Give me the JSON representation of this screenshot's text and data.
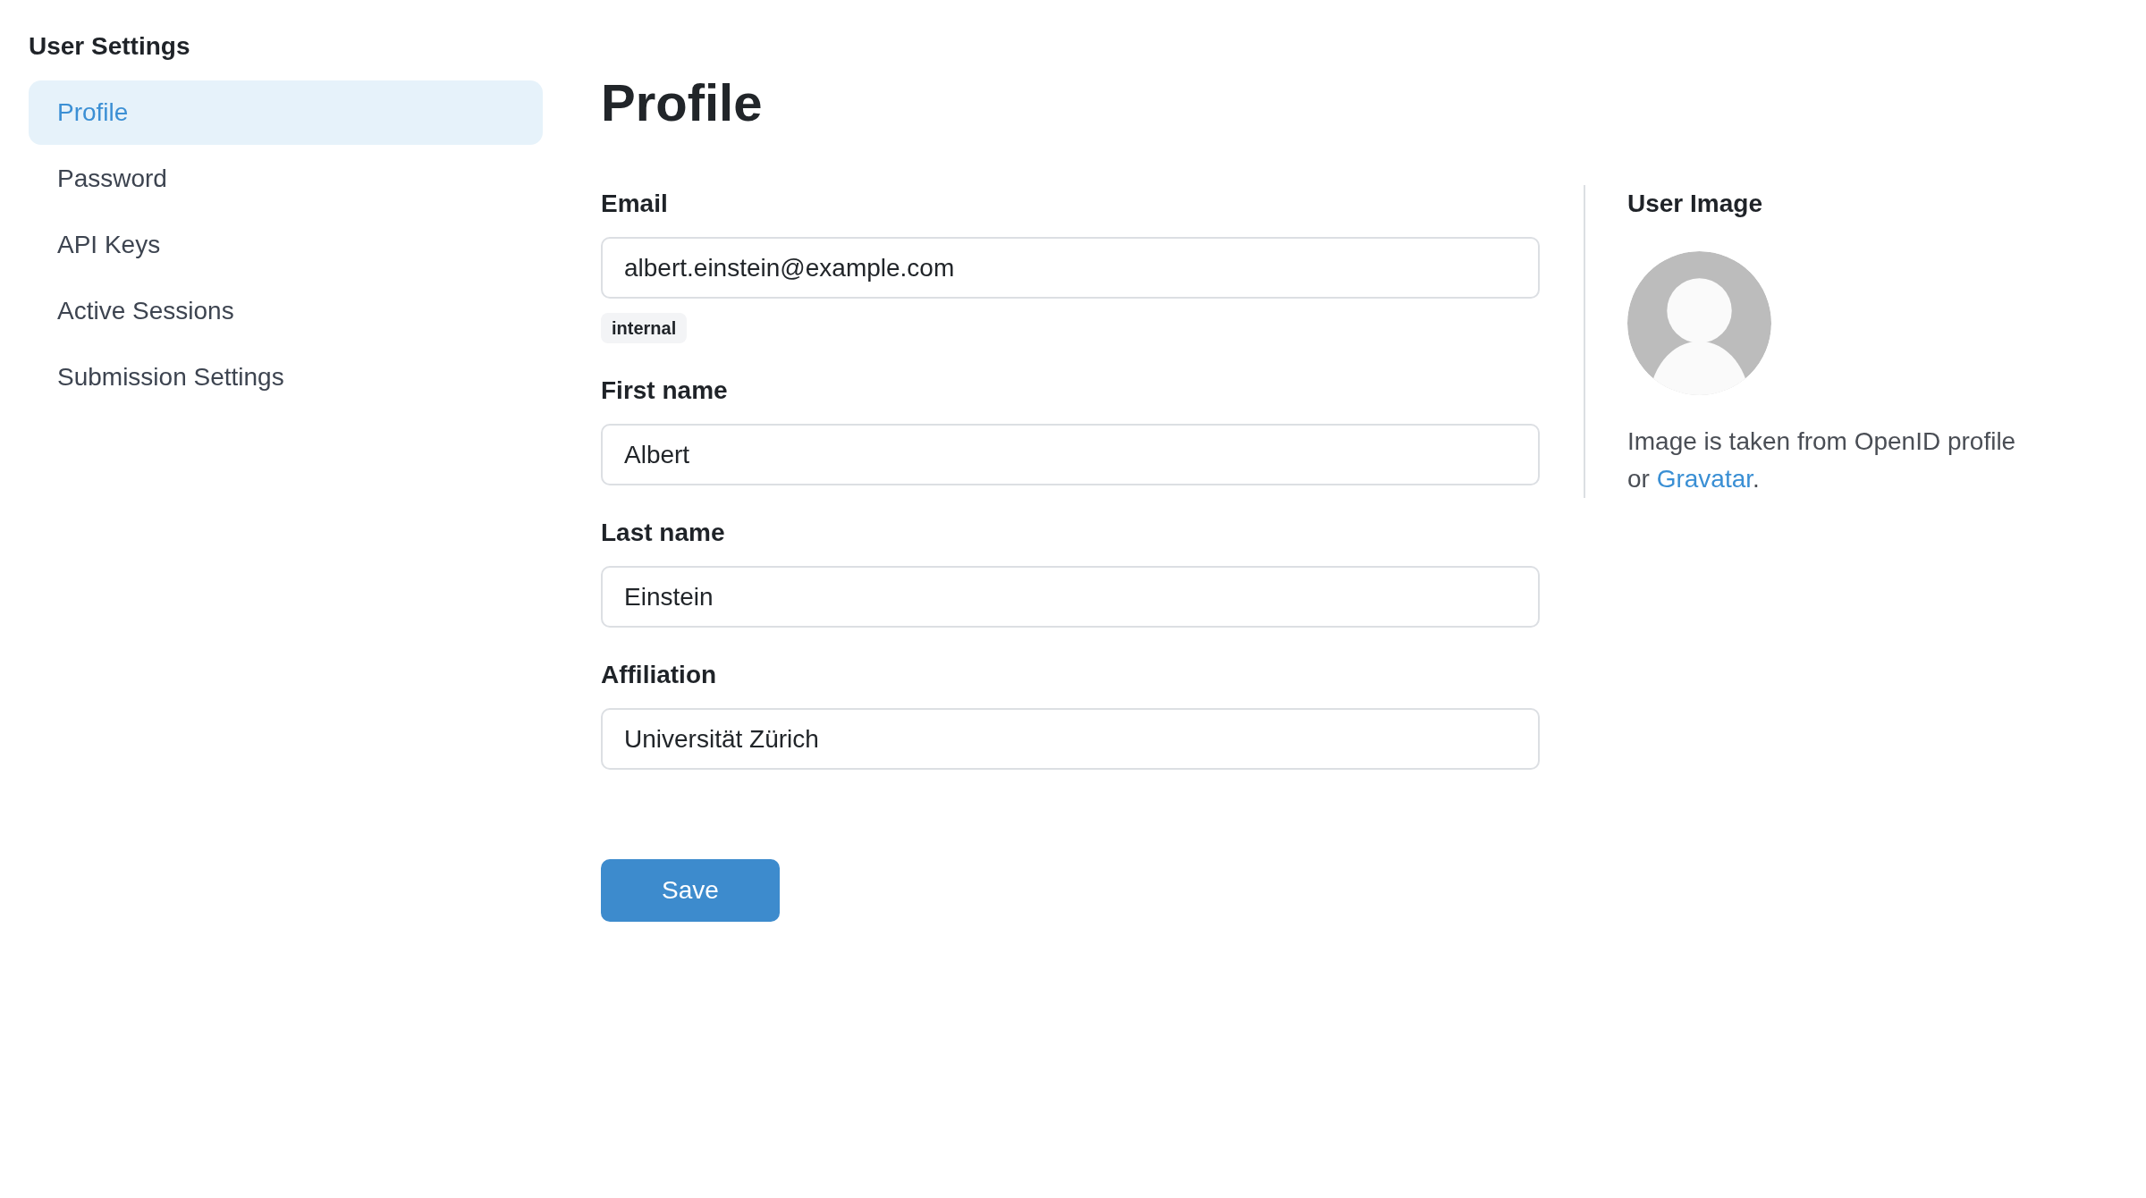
{
  "sidebar": {
    "title": "User Settings",
    "items": [
      {
        "label": "Profile",
        "selected": true
      },
      {
        "label": "Password",
        "selected": false
      },
      {
        "label": "API Keys",
        "selected": false
      },
      {
        "label": "Active Sessions",
        "selected": false
      },
      {
        "label": "Submission Settings",
        "selected": false
      }
    ]
  },
  "main": {
    "title": "Profile",
    "fields": [
      {
        "label": "Email",
        "value": "albert.einstein@example.com",
        "tag": "internal"
      },
      {
        "label": "First name",
        "value": "Albert"
      },
      {
        "label": "Last name",
        "value": "Einstein"
      },
      {
        "label": "Affiliation",
        "value": "Universität Zürich"
      }
    ],
    "save_button": "Save"
  },
  "user_image": {
    "title": "User Image",
    "note": "Image is taken from OpenID profile or",
    "link": "Gravatar",
    "note_end": "."
  }
}
